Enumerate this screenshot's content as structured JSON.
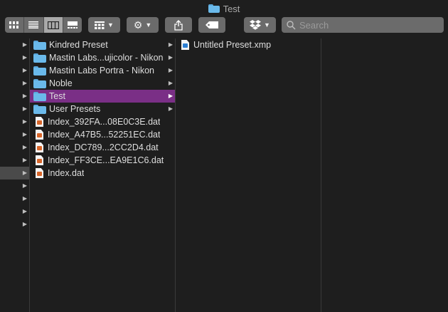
{
  "window": {
    "title": "Test"
  },
  "toolbar": {
    "search_placeholder": "Search"
  },
  "column1": {
    "row_count": 15,
    "selected_index": 10
  },
  "column2": {
    "items": [
      {
        "label": "Kindred Preset",
        "type": "folder",
        "has_children": true,
        "selected": false
      },
      {
        "label": "Mastin Labs...ujicolor - Nikon",
        "type": "folder",
        "has_children": true,
        "selected": false
      },
      {
        "label": "Mastin Labs Portra - Nikon",
        "type": "folder",
        "has_children": true,
        "selected": false
      },
      {
        "label": "Noble",
        "type": "folder",
        "has_children": true,
        "selected": false
      },
      {
        "label": "Test",
        "type": "folder",
        "has_children": true,
        "selected": true
      },
      {
        "label": "User Presets",
        "type": "folder",
        "has_children": true,
        "selected": false
      },
      {
        "label": "Index_392FA...08E0C3E.dat",
        "type": "dat",
        "has_children": false,
        "selected": false
      },
      {
        "label": "Index_A47B5...52251EC.dat",
        "type": "dat",
        "has_children": false,
        "selected": false
      },
      {
        "label": "Index_DC789...2CC2D4.dat",
        "type": "dat",
        "has_children": false,
        "selected": false
      },
      {
        "label": "Index_FF3CE...EA9E1C6.dat",
        "type": "dat",
        "has_children": false,
        "selected": false
      },
      {
        "label": "Index.dat",
        "type": "dat",
        "has_children": false,
        "selected": false
      }
    ]
  },
  "column3": {
    "items": [
      {
        "label": "Untitled Preset.xmp",
        "type": "xmp"
      }
    ]
  },
  "colors": {
    "selection": "#7a2f86",
    "folder": "#6ab9ea",
    "background": "#1e1e1e"
  }
}
